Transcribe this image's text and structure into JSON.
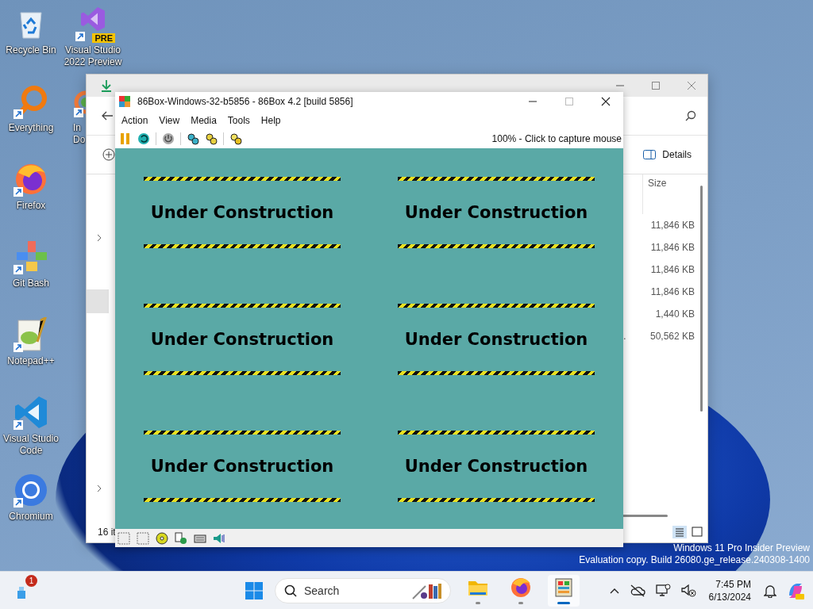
{
  "desktop_icons": [
    {
      "label": "Recycle Bin",
      "kind": "recycle",
      "shortcut": false
    },
    {
      "label": "Everything",
      "kind": "everything",
      "shortcut": true
    },
    {
      "label": "Firefox",
      "kind": "firefox",
      "shortcut": true
    },
    {
      "label": "Git Bash",
      "kind": "git",
      "shortcut": true
    },
    {
      "label": "Notepad++",
      "kind": "notepad",
      "shortcut": true
    },
    {
      "label": "Visual Studio Code",
      "kind": "vscode",
      "shortcut": true
    },
    {
      "label": "Chromium",
      "kind": "chromium",
      "shortcut": true
    },
    {
      "label": "Visual Studio 2022 Preview",
      "kind": "vs",
      "shortcut": true,
      "badge": "PRE"
    },
    {
      "label": "In Do",
      "kind": "partial",
      "shortcut": true
    }
  ],
  "explorer": {
    "view_button": "Details",
    "column_header": "Size",
    "rows": [
      {
        "size": "11,846 KB"
      },
      {
        "size": "11,846 KB"
      },
      {
        "size": "11,846 KB"
      },
      {
        "size": "11,846 KB"
      },
      {
        "size": "1,440 KB"
      },
      {
        "name": "…",
        "size": "50,562 KB"
      }
    ],
    "status": "16 it"
  },
  "emulator": {
    "title": "86Box-Windows-32-b5856 - 86Box 4.2 [build 5856]",
    "menu": [
      "Action",
      "View",
      "Media",
      "Tools",
      "Help"
    ],
    "status_text": "100% - Click to capture mouse",
    "screen_blocks": [
      "Under Construction",
      "Under Construction",
      "Under Construction",
      "Under Construction",
      "Under Construction",
      "Under Construction"
    ]
  },
  "watermark": [
    "Windows 11 Pro Insider Preview",
    "Evaluation copy. Build 26080.ge_release.240308-1400"
  ],
  "taskbar": {
    "widget_badge": "1",
    "search": {
      "placeholder": "Search"
    },
    "apps": [
      {
        "kind": "explorer",
        "running": true,
        "active": false
      },
      {
        "kind": "firefox",
        "running": true,
        "active": false
      },
      {
        "kind": "emulator",
        "running": true,
        "active": true
      }
    ],
    "time": "7:45 PM",
    "date": "6/13/2024"
  }
}
